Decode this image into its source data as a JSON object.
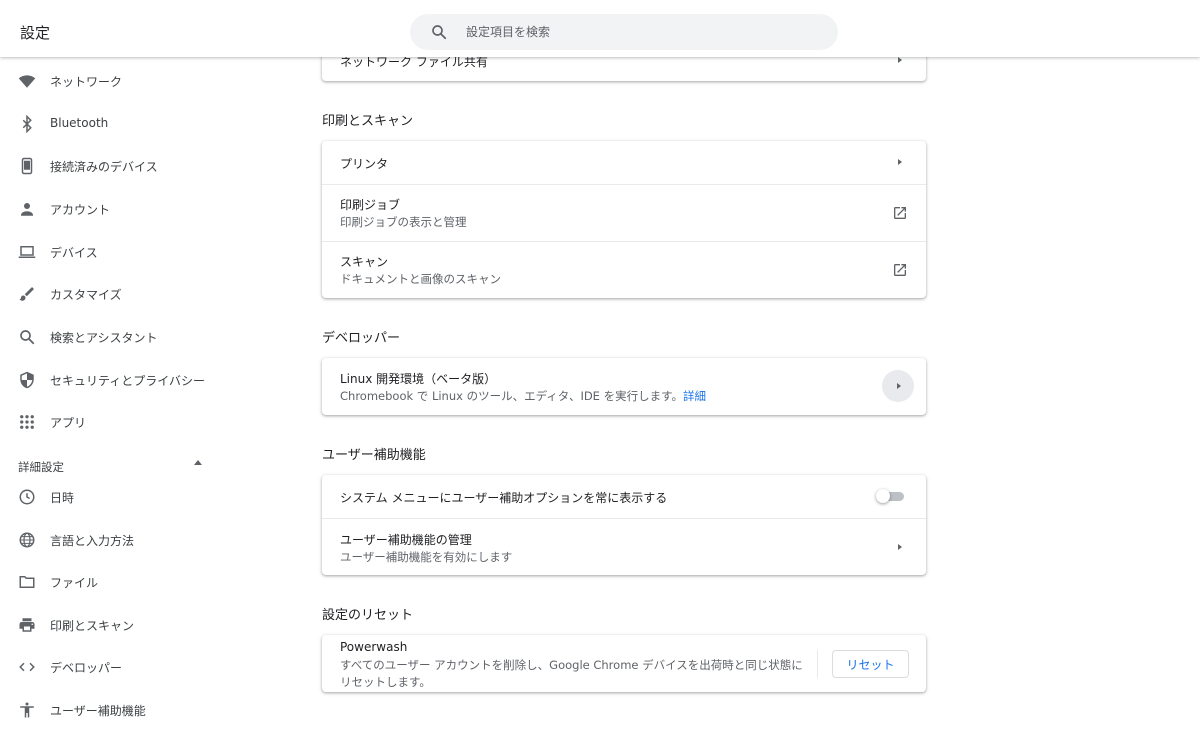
{
  "header": {
    "title": "設定",
    "search_placeholder": "設定項目を検索"
  },
  "sidebar": {
    "items": [
      {
        "label": "ネットワーク",
        "icon": "wifi-icon"
      },
      {
        "label": "Bluetooth",
        "icon": "bluetooth-icon"
      },
      {
        "label": "接続済みのデバイス",
        "icon": "phone-icon"
      },
      {
        "label": "アカウント",
        "icon": "person-icon"
      },
      {
        "label": "デバイス",
        "icon": "laptop-icon"
      },
      {
        "label": "カスタマイズ",
        "icon": "brush-icon"
      },
      {
        "label": "検索とアシスタント",
        "icon": "search-icon"
      },
      {
        "label": "セキュリティとプライバシー",
        "icon": "shield-icon"
      },
      {
        "label": "アプリ",
        "icon": "apps-grid-icon"
      }
    ],
    "advanced_label": "詳細設定",
    "advanced_items": [
      {
        "label": "日時",
        "icon": "clock-icon"
      },
      {
        "label": "言語と入力方法",
        "icon": "globe-icon"
      },
      {
        "label": "ファイル",
        "icon": "folder-icon"
      },
      {
        "label": "印刷とスキャン",
        "icon": "printer-icon"
      },
      {
        "label": "デベロッパー",
        "icon": "code-icon"
      },
      {
        "label": "ユーザー補助機能",
        "icon": "accessibility-icon"
      }
    ]
  },
  "main": {
    "files_card": {
      "row_title": "ネットワーク ファイル共有"
    },
    "print_section": {
      "title": "印刷とスキャン",
      "rows": [
        {
          "title": "プリンタ"
        },
        {
          "title": "印刷ジョブ",
          "sub": "印刷ジョブの表示と管理"
        },
        {
          "title": "スキャン",
          "sub": "ドキュメントと画像のスキャン"
        }
      ]
    },
    "developer_section": {
      "title": "デベロッパー",
      "row": {
        "title": "Linux 開発環境（ベータ版）",
        "sub": "Chromebook で Linux のツール、エディタ、IDE を実行します。",
        "link": "詳細"
      }
    },
    "accessibility_section": {
      "title": "ユーザー補助機能",
      "rows": [
        {
          "title": "システム メニューにユーザー補助オプションを常に表示する",
          "toggle_on": false
        },
        {
          "title": "ユーザー補助機能の管理",
          "sub": "ユーザー補助機能を有効にします"
        }
      ]
    },
    "reset_section": {
      "title": "設定のリセット",
      "row": {
        "title": "Powerwash",
        "sub_line1": "すべてのユーザー アカウントを削除し、Google Chrome デバイスを出荷時と同じ状態に",
        "sub_line2": "リセットします。",
        "button": "リセット"
      }
    }
  },
  "colors": {
    "accent": "#1a73e8",
    "icon": "#5f6368",
    "text": "#202124"
  }
}
